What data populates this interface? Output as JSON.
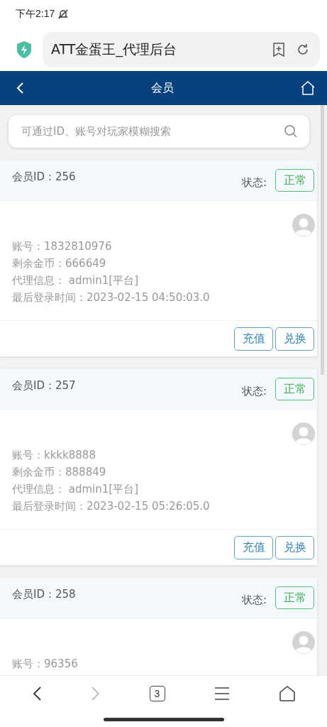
{
  "status_bar": {
    "time": "下午2:17"
  },
  "browser": {
    "page_title": "ATT金蛋王_代理后台"
  },
  "nav": {
    "title": "会员"
  },
  "search": {
    "placeholder": "可通过ID、账号对玩家模糊搜索"
  },
  "members": [
    {
      "member_id": "会员ID：256",
      "status_label": "状态:",
      "status": "正常",
      "lines": [
        "账号：1832810976",
        "剩余金币：666649",
        "代理信息： admin1[平台]",
        "最后登录时间：2023-02-15 04:50:03.0"
      ],
      "buttons": [
        "充值",
        "兑换"
      ]
    },
    {
      "member_id": "会员ID：257",
      "status_label": "状态:",
      "status": "正常",
      "lines": [
        "账号：kkkk8888",
        "剩余金币：888849",
        "代理信息： admin1[平台]",
        "最后登录时间：2023-02-15 05:26:05.0"
      ],
      "buttons": [
        "充值",
        "兑换"
      ]
    },
    {
      "member_id": "会员ID：258",
      "status_label": "状态:",
      "status": "正常",
      "lines": [
        "账号：96356"
      ]
    }
  ],
  "toolbar": {
    "tab_count": "3"
  }
}
